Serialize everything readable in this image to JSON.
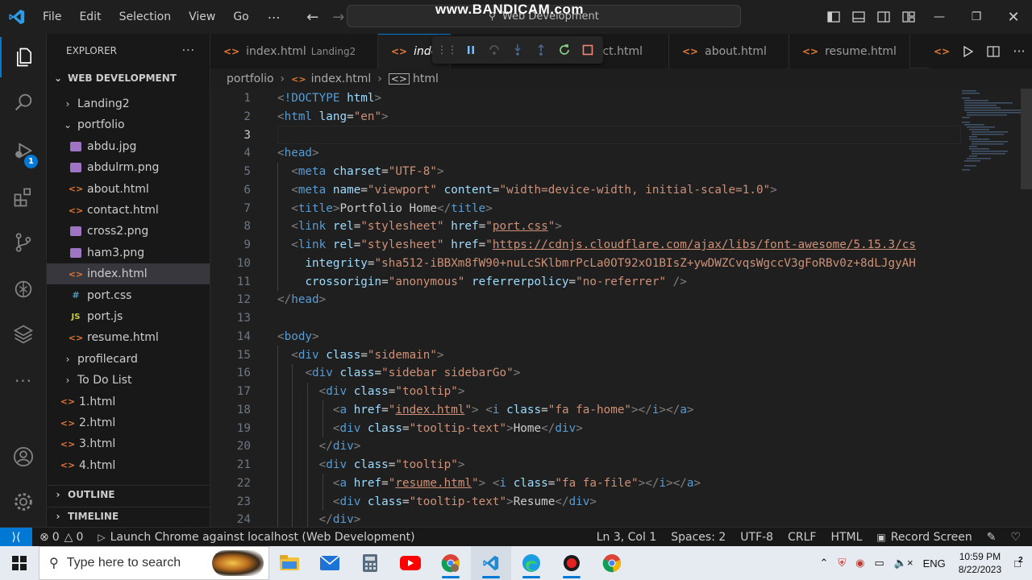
{
  "titlebar": {
    "menu": [
      "File",
      "Edit",
      "Selection",
      "View",
      "Go"
    ],
    "more": "⋯",
    "command_center": "Web Development",
    "watermark": "www.BANDICAM.com"
  },
  "activity": {
    "debug_badge": "1"
  },
  "explorer": {
    "title": "EXPLORER",
    "more": "···",
    "workspace": "WEB DEVELOPMENT",
    "tree": [
      {
        "label": "Landing2",
        "kind": "folder",
        "open": false,
        "depth": 1
      },
      {
        "label": "portfolio",
        "kind": "folder",
        "open": true,
        "depth": 1
      },
      {
        "label": "abdu.jpg",
        "kind": "img",
        "depth": 2
      },
      {
        "label": "abdulrm.png",
        "kind": "img",
        "depth": 2
      },
      {
        "label": "about.html",
        "kind": "html",
        "depth": 2
      },
      {
        "label": "contact.html",
        "kind": "html",
        "depth": 2
      },
      {
        "label": "cross2.png",
        "kind": "img",
        "depth": 2
      },
      {
        "label": "ham3.png",
        "kind": "img",
        "depth": 2
      },
      {
        "label": "index.html",
        "kind": "html",
        "depth": 2,
        "selected": true
      },
      {
        "label": "port.css",
        "kind": "css",
        "depth": 2
      },
      {
        "label": "port.js",
        "kind": "js",
        "depth": 2
      },
      {
        "label": "resume.html",
        "kind": "html",
        "depth": 2
      },
      {
        "label": "profilecard",
        "kind": "folder",
        "open": false,
        "depth": 1
      },
      {
        "label": "To Do List",
        "kind": "folder",
        "open": false,
        "depth": 1
      },
      {
        "label": "1.html",
        "kind": "html",
        "depth": 1
      },
      {
        "label": "2.html",
        "kind": "html",
        "depth": 1
      },
      {
        "label": "3.html",
        "kind": "html",
        "depth": 1
      },
      {
        "label": "4.html",
        "kind": "html",
        "depth": 1
      }
    ],
    "outline": "OUTLINE",
    "timeline": "TIMELINE"
  },
  "tabs": [
    {
      "label": "index.html",
      "desc": "Landing2"
    },
    {
      "label": "inde",
      "desc": "",
      "active": true
    },
    {
      "label": "ct.html",
      "desc": ""
    },
    {
      "label": "about.html",
      "desc": ""
    },
    {
      "label": "resume.html",
      "desc": ""
    }
  ],
  "breadcrumb": [
    "portfolio",
    "index.html",
    "html"
  ],
  "editor": {
    "current_line": 3,
    "lines": [
      [
        [
          "b",
          "<"
        ],
        [
          "tag",
          "!DOCTYPE"
        ],
        [
          "txt",
          " "
        ],
        [
          "attr",
          "html"
        ],
        [
          "b",
          ">"
        ]
      ],
      [
        [
          "b",
          "<"
        ],
        [
          "tag",
          "html"
        ],
        [
          "txt",
          " "
        ],
        [
          "attr",
          "lang"
        ],
        [
          "txt",
          "="
        ],
        [
          "str",
          "\"en\""
        ],
        [
          "b",
          ">"
        ]
      ],
      [],
      [
        [
          "b",
          "<"
        ],
        [
          "tag",
          "head"
        ],
        [
          "b",
          ">"
        ]
      ],
      [
        [
          "txt",
          "  "
        ],
        [
          "b",
          "<"
        ],
        [
          "tag",
          "meta"
        ],
        [
          "txt",
          " "
        ],
        [
          "attr",
          "charset"
        ],
        [
          "txt",
          "="
        ],
        [
          "str",
          "\"UTF-8\""
        ],
        [
          "b",
          ">"
        ]
      ],
      [
        [
          "txt",
          "  "
        ],
        [
          "b",
          "<"
        ],
        [
          "tag",
          "meta"
        ],
        [
          "txt",
          " "
        ],
        [
          "attr",
          "name"
        ],
        [
          "txt",
          "="
        ],
        [
          "str",
          "\"viewport\""
        ],
        [
          "txt",
          " "
        ],
        [
          "attr",
          "content"
        ],
        [
          "txt",
          "="
        ],
        [
          "str",
          "\"width=device-width, initial-scale=1.0\""
        ],
        [
          "b",
          ">"
        ]
      ],
      [
        [
          "txt",
          "  "
        ],
        [
          "b",
          "<"
        ],
        [
          "tag",
          "title"
        ],
        [
          "b",
          ">"
        ],
        [
          "txt",
          "Portfolio Home"
        ],
        [
          "b",
          "</"
        ],
        [
          "tag",
          "title"
        ],
        [
          "b",
          ">"
        ]
      ],
      [
        [
          "txt",
          "  "
        ],
        [
          "b",
          "<"
        ],
        [
          "tag",
          "link"
        ],
        [
          "txt",
          " "
        ],
        [
          "attr",
          "rel"
        ],
        [
          "txt",
          "="
        ],
        [
          "str",
          "\"stylesheet\""
        ],
        [
          "txt",
          " "
        ],
        [
          "attr",
          "href"
        ],
        [
          "txt",
          "="
        ],
        [
          "str",
          "\""
        ],
        [
          "strl",
          "port.css"
        ],
        [
          "str",
          "\""
        ],
        [
          "b",
          ">"
        ]
      ],
      [
        [
          "txt",
          "  "
        ],
        [
          "b",
          "<"
        ],
        [
          "tag",
          "link"
        ],
        [
          "txt",
          " "
        ],
        [
          "attr",
          "rel"
        ],
        [
          "txt",
          "="
        ],
        [
          "str",
          "\"stylesheet\""
        ],
        [
          "txt",
          " "
        ],
        [
          "attr",
          "href"
        ],
        [
          "txt",
          "="
        ],
        [
          "str",
          "\""
        ],
        [
          "strl",
          "https://cdnjs.cloudflare.com/ajax/libs/font-awesome/5.15.3/cs"
        ]
      ],
      [
        [
          "txt",
          "    "
        ],
        [
          "attr",
          "integrity"
        ],
        [
          "txt",
          "="
        ],
        [
          "str",
          "\"sha512-iBBXm8fW90+nuLcSKlbmrPcLa0OT92xO1BIsZ+ywDWZCvqsWgccV3gFoRBv0z+8dLJgyAH"
        ]
      ],
      [
        [
          "txt",
          "    "
        ],
        [
          "attr",
          "crossorigin"
        ],
        [
          "txt",
          "="
        ],
        [
          "str",
          "\"anonymous\""
        ],
        [
          "txt",
          " "
        ],
        [
          "attr",
          "referrerpolicy"
        ],
        [
          "txt",
          "="
        ],
        [
          "str",
          "\"no-referrer\""
        ],
        [
          "txt",
          " "
        ],
        [
          "b",
          "/>"
        ]
      ],
      [
        [
          "b",
          "</"
        ],
        [
          "tag",
          "head"
        ],
        [
          "b",
          ">"
        ]
      ],
      [],
      [
        [
          "b",
          "<"
        ],
        [
          "tag",
          "body"
        ],
        [
          "b",
          ">"
        ]
      ],
      [
        [
          "txt",
          "  "
        ],
        [
          "b",
          "<"
        ],
        [
          "tag",
          "div"
        ],
        [
          "txt",
          " "
        ],
        [
          "attr",
          "class"
        ],
        [
          "txt",
          "="
        ],
        [
          "str",
          "\"sidemain\""
        ],
        [
          "b",
          ">"
        ]
      ],
      [
        [
          "txt",
          "    "
        ],
        [
          "b",
          "<"
        ],
        [
          "tag",
          "div"
        ],
        [
          "txt",
          " "
        ],
        [
          "attr",
          "class"
        ],
        [
          "txt",
          "="
        ],
        [
          "str",
          "\"sidebar sidebarGo\""
        ],
        [
          "b",
          ">"
        ]
      ],
      [
        [
          "txt",
          "      "
        ],
        [
          "b",
          "<"
        ],
        [
          "tag",
          "div"
        ],
        [
          "txt",
          " "
        ],
        [
          "attr",
          "class"
        ],
        [
          "txt",
          "="
        ],
        [
          "str",
          "\"tooltip\""
        ],
        [
          "b",
          ">"
        ]
      ],
      [
        [
          "txt",
          "        "
        ],
        [
          "b",
          "<"
        ],
        [
          "tag",
          "a"
        ],
        [
          "txt",
          " "
        ],
        [
          "attr",
          "href"
        ],
        [
          "txt",
          "="
        ],
        [
          "str",
          "\""
        ],
        [
          "strl",
          "index.html"
        ],
        [
          "str",
          "\""
        ],
        [
          "b",
          ">"
        ],
        [
          "txt",
          " "
        ],
        [
          "b",
          "<"
        ],
        [
          "tag",
          "i"
        ],
        [
          "txt",
          " "
        ],
        [
          "attr",
          "class"
        ],
        [
          "txt",
          "="
        ],
        [
          "str",
          "\"fa fa-home\""
        ],
        [
          "b",
          ">"
        ],
        [
          "b",
          "</"
        ],
        [
          "tag",
          "i"
        ],
        [
          "b",
          ">"
        ],
        [
          "b",
          "</"
        ],
        [
          "tag",
          "a"
        ],
        [
          "b",
          ">"
        ]
      ],
      [
        [
          "txt",
          "        "
        ],
        [
          "b",
          "<"
        ],
        [
          "tag",
          "div"
        ],
        [
          "txt",
          " "
        ],
        [
          "attr",
          "class"
        ],
        [
          "txt",
          "="
        ],
        [
          "str",
          "\"tooltip-text\""
        ],
        [
          "b",
          ">"
        ],
        [
          "txt",
          "Home"
        ],
        [
          "b",
          "</"
        ],
        [
          "tag",
          "div"
        ],
        [
          "b",
          ">"
        ]
      ],
      [
        [
          "txt",
          "      "
        ],
        [
          "b",
          "</"
        ],
        [
          "tag",
          "div"
        ],
        [
          "b",
          ">"
        ]
      ],
      [
        [
          "txt",
          "      "
        ],
        [
          "b",
          "<"
        ],
        [
          "tag",
          "div"
        ],
        [
          "txt",
          " "
        ],
        [
          "attr",
          "class"
        ],
        [
          "txt",
          "="
        ],
        [
          "str",
          "\"tooltip\""
        ],
        [
          "b",
          ">"
        ]
      ],
      [
        [
          "txt",
          "        "
        ],
        [
          "b",
          "<"
        ],
        [
          "tag",
          "a"
        ],
        [
          "txt",
          " "
        ],
        [
          "attr",
          "href"
        ],
        [
          "txt",
          "="
        ],
        [
          "str",
          "\""
        ],
        [
          "strl",
          "resume.html"
        ],
        [
          "str",
          "\""
        ],
        [
          "b",
          ">"
        ],
        [
          "txt",
          " "
        ],
        [
          "b",
          "<"
        ],
        [
          "tag",
          "i"
        ],
        [
          "txt",
          " "
        ],
        [
          "attr",
          "class"
        ],
        [
          "txt",
          "="
        ],
        [
          "str",
          "\"fa fa-file\""
        ],
        [
          "b",
          ">"
        ],
        [
          "b",
          "</"
        ],
        [
          "tag",
          "i"
        ],
        [
          "b",
          ">"
        ],
        [
          "b",
          "</"
        ],
        [
          "tag",
          "a"
        ],
        [
          "b",
          ">"
        ]
      ],
      [
        [
          "txt",
          "        "
        ],
        [
          "b",
          "<"
        ],
        [
          "tag",
          "div"
        ],
        [
          "txt",
          " "
        ],
        [
          "attr",
          "class"
        ],
        [
          "txt",
          "="
        ],
        [
          "str",
          "\"tooltip-text\""
        ],
        [
          "b",
          ">"
        ],
        [
          "txt",
          "Resume"
        ],
        [
          "b",
          "</"
        ],
        [
          "tag",
          "div"
        ],
        [
          "b",
          ">"
        ]
      ],
      [
        [
          "txt",
          "      "
        ],
        [
          "b",
          "</"
        ],
        [
          "tag",
          "div"
        ],
        [
          "b",
          ">"
        ]
      ]
    ]
  },
  "statusbar": {
    "errors": "0",
    "warnings": "0",
    "launch": "Launch Chrome against localhost (Web Development)",
    "position": "Ln 3, Col 1",
    "spaces": "Spaces: 2",
    "encoding": "UTF-8",
    "eol": "CRLF",
    "language": "HTML",
    "record": "Record Screen"
  },
  "taskbar": {
    "search_placeholder": "Type here to search",
    "lang": "ENG",
    "time": "10:59 PM",
    "date": "8/22/2023",
    "notifications": "2"
  },
  "colors": {
    "accent": "#0078d4",
    "tag": "#569cd6",
    "attr": "#9cdcfe",
    "string": "#ce9178"
  }
}
